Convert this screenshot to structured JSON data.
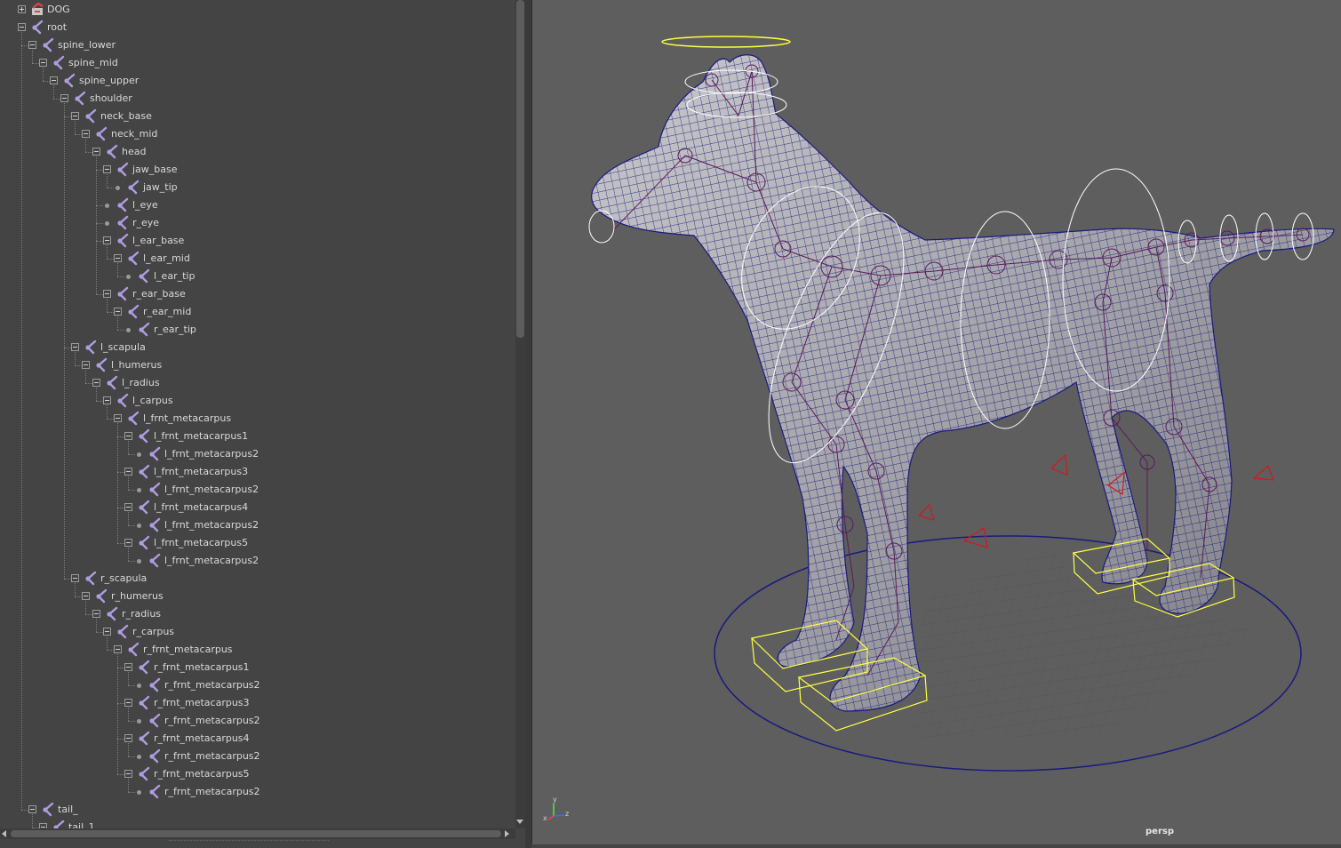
{
  "outliner": {
    "items": [
      {
        "label": "DOG",
        "depth": 0,
        "kind": "set",
        "state": "collapsed"
      },
      {
        "label": "root",
        "depth": 0,
        "kind": "joint",
        "state": "expanded"
      },
      {
        "label": "spine_lower",
        "depth": 1,
        "kind": "joint",
        "state": "expanded"
      },
      {
        "label": "spine_mid",
        "depth": 2,
        "kind": "joint",
        "state": "expanded"
      },
      {
        "label": "spine_upper",
        "depth": 3,
        "kind": "joint",
        "state": "expanded"
      },
      {
        "label": "shoulder",
        "depth": 4,
        "kind": "joint",
        "state": "expanded"
      },
      {
        "label": "neck_base",
        "depth": 5,
        "kind": "joint",
        "state": "expanded"
      },
      {
        "label": "neck_mid",
        "depth": 6,
        "kind": "joint",
        "state": "expanded"
      },
      {
        "label": "head",
        "depth": 7,
        "kind": "joint",
        "state": "expanded"
      },
      {
        "label": "jaw_base",
        "depth": 8,
        "kind": "joint",
        "state": "expanded"
      },
      {
        "label": "jaw_tip",
        "depth": 9,
        "kind": "joint",
        "state": "leaf"
      },
      {
        "label": "l_eye",
        "depth": 8,
        "kind": "joint",
        "state": "leaf"
      },
      {
        "label": "r_eye",
        "depth": 8,
        "kind": "joint",
        "state": "leaf"
      },
      {
        "label": "l_ear_base",
        "depth": 8,
        "kind": "joint",
        "state": "expanded"
      },
      {
        "label": "l_ear_mid",
        "depth": 9,
        "kind": "joint",
        "state": "expanded"
      },
      {
        "label": "l_ear_tip",
        "depth": 10,
        "kind": "joint",
        "state": "leaf"
      },
      {
        "label": "r_ear_base",
        "depth": 8,
        "kind": "joint",
        "state": "expanded"
      },
      {
        "label": "r_ear_mid",
        "depth": 9,
        "kind": "joint",
        "state": "expanded"
      },
      {
        "label": "r_ear_tip",
        "depth": 10,
        "kind": "joint",
        "state": "leaf"
      },
      {
        "label": "l_scapula",
        "depth": 5,
        "kind": "joint",
        "state": "expanded"
      },
      {
        "label": "l_humerus",
        "depth": 6,
        "kind": "joint",
        "state": "expanded"
      },
      {
        "label": "l_radius",
        "depth": 7,
        "kind": "joint",
        "state": "expanded"
      },
      {
        "label": "l_carpus",
        "depth": 8,
        "kind": "joint",
        "state": "expanded"
      },
      {
        "label": "l_frnt_metacarpus",
        "depth": 9,
        "kind": "joint",
        "state": "expanded"
      },
      {
        "label": "l_frnt_metacarpus1",
        "depth": 10,
        "kind": "joint",
        "state": "expanded"
      },
      {
        "label": "l_frnt_metacarpus2",
        "depth": 11,
        "kind": "joint",
        "state": "leaf"
      },
      {
        "label": "l_frnt_metacarpus3",
        "depth": 10,
        "kind": "joint",
        "state": "expanded"
      },
      {
        "label": "l_frnt_metacarpus2",
        "depth": 11,
        "kind": "joint",
        "state": "leaf"
      },
      {
        "label": "l_frnt_metacarpus4",
        "depth": 10,
        "kind": "joint",
        "state": "expanded"
      },
      {
        "label": "l_frnt_metacarpus2",
        "depth": 11,
        "kind": "joint",
        "state": "leaf"
      },
      {
        "label": "l_frnt_metacarpus5",
        "depth": 10,
        "kind": "joint",
        "state": "expanded"
      },
      {
        "label": "l_frnt_metacarpus2",
        "depth": 11,
        "kind": "joint",
        "state": "leaf"
      },
      {
        "label": "r_scapula",
        "depth": 5,
        "kind": "joint",
        "state": "expanded"
      },
      {
        "label": "r_humerus",
        "depth": 6,
        "kind": "joint",
        "state": "expanded"
      },
      {
        "label": "r_radius",
        "depth": 7,
        "kind": "joint",
        "state": "expanded"
      },
      {
        "label": "r_carpus",
        "depth": 8,
        "kind": "joint",
        "state": "expanded"
      },
      {
        "label": "r_frnt_metacarpus",
        "depth": 9,
        "kind": "joint",
        "state": "expanded"
      },
      {
        "label": "r_frnt_metacarpus1",
        "depth": 10,
        "kind": "joint",
        "state": "expanded"
      },
      {
        "label": "r_frnt_metacarpus2",
        "depth": 11,
        "kind": "joint",
        "state": "leaf"
      },
      {
        "label": "r_frnt_metacarpus3",
        "depth": 10,
        "kind": "joint",
        "state": "expanded"
      },
      {
        "label": "r_frnt_metacarpus2",
        "depth": 11,
        "kind": "joint",
        "state": "leaf"
      },
      {
        "label": "r_frnt_metacarpus4",
        "depth": 10,
        "kind": "joint",
        "state": "expanded"
      },
      {
        "label": "r_frnt_metacarpus2",
        "depth": 11,
        "kind": "joint",
        "state": "leaf"
      },
      {
        "label": "r_frnt_metacarpus5",
        "depth": 10,
        "kind": "joint",
        "state": "expanded"
      },
      {
        "label": "r_frnt_metacarpus2",
        "depth": 11,
        "kind": "joint",
        "state": "leaf"
      },
      {
        "label": "tail_",
        "depth": 1,
        "kind": "joint",
        "state": "expanded"
      },
      {
        "label": "tail_1",
        "depth": 2,
        "kind": "joint",
        "state": "expanded"
      }
    ]
  },
  "viewport": {
    "camera_label": "persp",
    "axis": {
      "x": "x",
      "y": "y",
      "z": "z"
    }
  },
  "colors": {
    "panel_bg": "#444444",
    "viewport_bg": "#5e5e5e",
    "wireframe": "#1a1a80",
    "joint": "#5a1a5a",
    "control_white": "#ffffff",
    "control_yellow": "#ffff44",
    "locator_red": "#d11a1a",
    "joint_icon": "#b09ce0"
  },
  "icons": {
    "joint": "joint-icon",
    "set": "set-icon",
    "expand": "expand-toggle-icon"
  }
}
